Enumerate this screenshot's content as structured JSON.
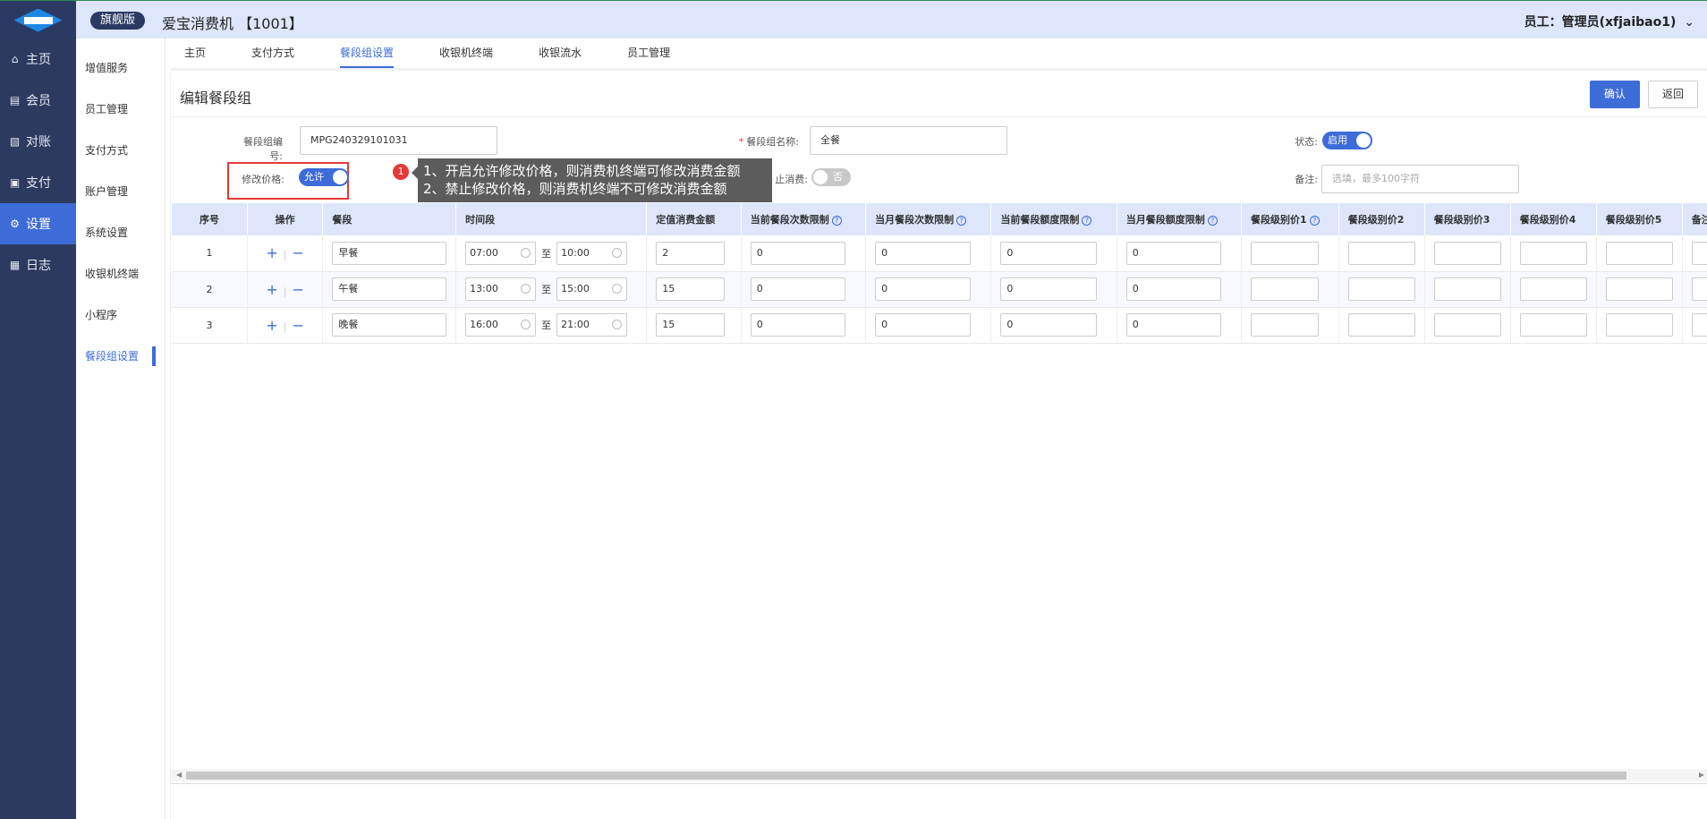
{
  "header": {
    "edition": "旗舰版",
    "title": "爱宝消费机 【1001】",
    "user": "员工：管理员(xfjaibao1)",
    "user_menu_icon": "chevron-down-icon"
  },
  "sidebar": {
    "items": [
      {
        "label": "主页",
        "icon": "home-icon"
      },
      {
        "label": "会员",
        "icon": "member-icon"
      },
      {
        "label": "对账",
        "icon": "reconcile-icon"
      },
      {
        "label": "支付",
        "icon": "pay-icon"
      },
      {
        "label": "设置",
        "icon": "gear-icon",
        "active": true
      },
      {
        "label": "日志",
        "icon": "log-icon"
      }
    ]
  },
  "subnav": {
    "items": [
      {
        "label": "增值服务"
      },
      {
        "label": "员工管理"
      },
      {
        "label": "支付方式"
      },
      {
        "label": "账户管理"
      },
      {
        "label": "系统设置"
      },
      {
        "label": "收银机终端"
      },
      {
        "label": "小程序"
      },
      {
        "label": "餐段组设置",
        "active": true
      }
    ]
  },
  "tabs": [
    {
      "label": "主页"
    },
    {
      "label": "支付方式"
    },
    {
      "label": "餐段组设置",
      "active": true
    },
    {
      "label": "收银机终端"
    },
    {
      "label": "收银流水"
    },
    {
      "label": "员工管理"
    }
  ],
  "form": {
    "title": "编辑餐段组",
    "confirm_label": "确认",
    "back_label": "返回",
    "code_label": "餐段组编号:",
    "code_value": "MPG240329101031",
    "name_required": "*",
    "name_label": "餐段组名称:",
    "name_value": "全餐",
    "status_label": "状态:",
    "status_value": "启用",
    "price_label": "修改价格:",
    "price_value": "允许",
    "prohibit_label": "止消费:",
    "prohibit_value": "否",
    "remark_label": "备注:",
    "remark_placeholder": "选填，最多100字符"
  },
  "tooltip": {
    "badge": "1",
    "line1": "1、开启允许修改价格，则消费机终端可修改消费金额",
    "line2": "2、禁止修改价格，则消费机终端不可修改消费金额"
  },
  "table": {
    "headers": {
      "seq": "序号",
      "op": "操作",
      "meal": "餐段",
      "time": "时间段",
      "amount": "定值消费金额",
      "cur_count": "当前餐段次数限制",
      "month_count": "当月餐段次数限制",
      "cur_amount": "当前餐段额度限制",
      "month_amount": "当月餐段额度限制",
      "level1": "餐段级别价1",
      "level2": "餐段级别价2",
      "level3": "餐段级别价3",
      "level4": "餐段级别价4",
      "level5": "餐段级别价5",
      "remark": "备注",
      "help": "?"
    },
    "op_add": "+",
    "op_remove": "−",
    "to_label": "至",
    "rows": [
      {
        "seq": "1",
        "meal": "早餐",
        "start": "07:00",
        "end": "10:00",
        "amount": "2",
        "cur_count": "0",
        "month_count": "0",
        "cur_amount": "0",
        "month_amount": "0"
      },
      {
        "seq": "2",
        "meal": "午餐",
        "start": "13:00",
        "end": "15:00",
        "amount": "15",
        "cur_count": "0",
        "month_count": "0",
        "cur_amount": "0",
        "month_amount": "0"
      },
      {
        "seq": "3",
        "meal": "晚餐",
        "start": "16:00",
        "end": "21:00",
        "amount": "15",
        "cur_count": "0",
        "month_count": "0",
        "cur_amount": "0",
        "month_amount": "0"
      }
    ]
  },
  "colors": {
    "accent": "#3d6bd8",
    "sidebar_bg": "#2d3a60",
    "header_bg": "#dde6fb",
    "highlight": "#e53935"
  }
}
